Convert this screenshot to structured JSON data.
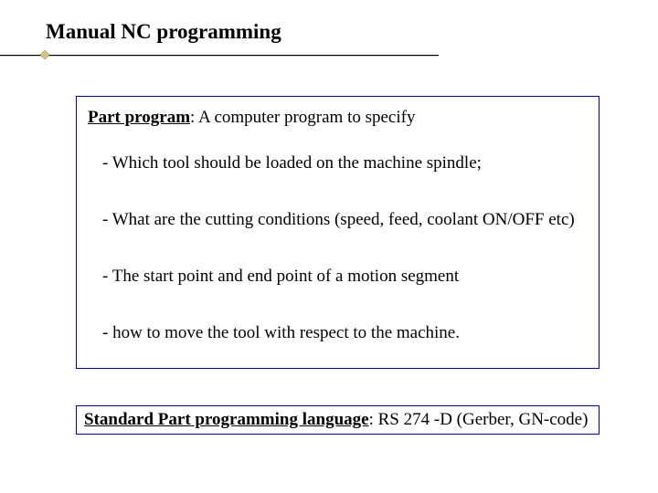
{
  "title": "Manual NC programming",
  "box1": {
    "term": "Part program",
    "definition": ": A computer program to specify",
    "items": [
      "- Which tool should be loaded on the machine spindle;",
      "- What are the cutting conditions (speed, feed, coolant ON/OFF etc)",
      "- The start point and end point of a motion segment",
      "- how to move the tool with respect to the machine."
    ]
  },
  "box2": {
    "term": "Standard Part programming language",
    "value": ": RS 274 -D (Gerber, GN-code)"
  }
}
